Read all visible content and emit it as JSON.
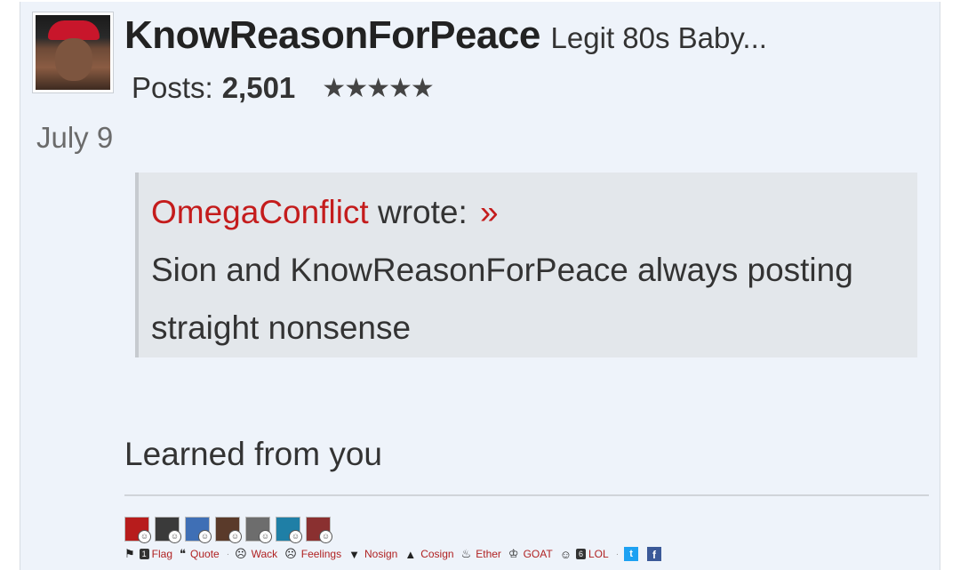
{
  "post": {
    "author": "KnowReasonForPeace",
    "tagline": "Legit 80s Baby...",
    "posts_label": "Posts:",
    "posts_count": "2,501",
    "stars": "★★★★★",
    "date": "July 9"
  },
  "quote": {
    "author": "OmegaConflict",
    "wrote": "wrote:",
    "arrow": "»",
    "line1": "Sion and KnowReasonForPeace always posting",
    "line2": "straight nonsense"
  },
  "body": {
    "text": "Learned from you"
  },
  "reactors": [
    {
      "name": "reactor-1",
      "color": "#b71c1c",
      "badge": "☺"
    },
    {
      "name": "reactor-2",
      "color": "#3a3a3a",
      "badge": "☺"
    },
    {
      "name": "reactor-3",
      "color": "#3f6fb5",
      "badge": "☺"
    },
    {
      "name": "reactor-4",
      "color": "#5a3a2a",
      "badge": "☺"
    },
    {
      "name": "reactor-5",
      "color": "#6d6d6d",
      "badge": "☺"
    },
    {
      "name": "reactor-6",
      "color": "#1f7fa6",
      "badge": "☺"
    },
    {
      "name": "reactor-7",
      "color": "#8a3030",
      "badge": "☺"
    }
  ],
  "actions": {
    "flag_count": "1",
    "flag": "Flag",
    "quote": "Quote",
    "wack": "Wack",
    "feelings": "Feelings",
    "nosign": "Nosign",
    "cosign": "Cosign",
    "ether": "Ether",
    "goat": "GOAT",
    "lol_count": "6",
    "lol": "LOL"
  },
  "share": {
    "twitter": "t",
    "facebook": "f"
  }
}
